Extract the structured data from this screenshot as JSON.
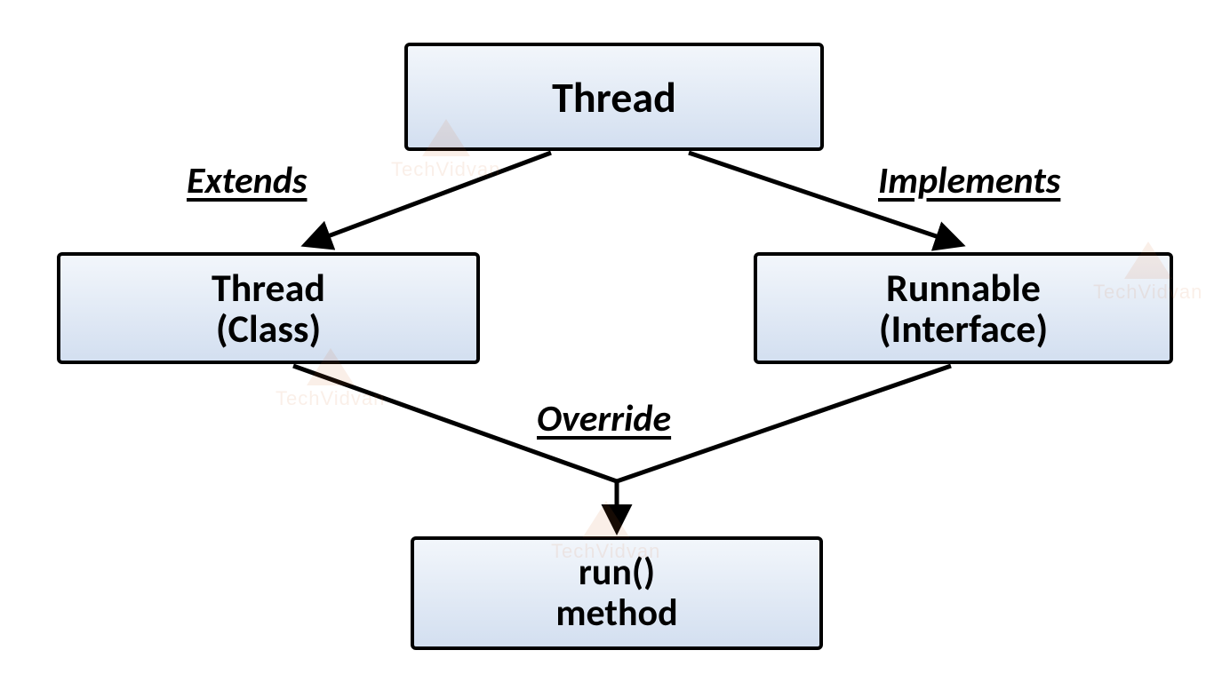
{
  "nodes": {
    "thread": {
      "label": "Thread"
    },
    "thread_class": {
      "line1": "Thread",
      "line2": "(Class)"
    },
    "runnable": {
      "line1": "Runnable",
      "line2": "(Interface)"
    },
    "run_method": {
      "line1": "run()",
      "line2": "method"
    }
  },
  "edges": {
    "extends": {
      "label": "Extends"
    },
    "implements": {
      "label": "Implements"
    },
    "override": {
      "label": "Override"
    }
  },
  "watermark": {
    "text": "TechVidvan"
  },
  "colors": {
    "box_border": "#000000",
    "box_grad_top": "#f2f6fb",
    "box_grad_bottom": "#d3dff0",
    "watermark": "#d46a2e"
  }
}
